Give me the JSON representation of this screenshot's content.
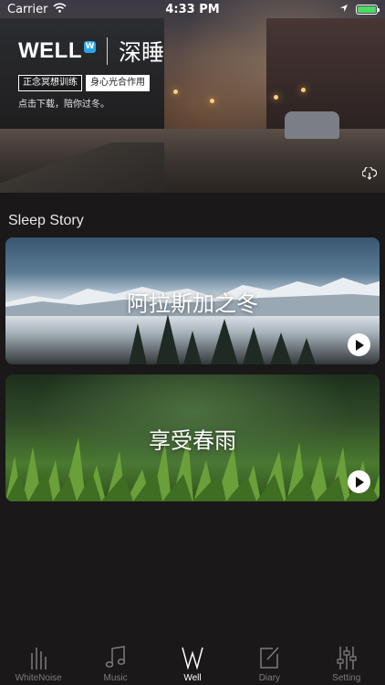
{
  "status_bar": {
    "carrier": "Carrier",
    "time": "4:33 PM"
  },
  "hero": {
    "logo_text": "WELL",
    "logo_badge": "W",
    "title": "深睡",
    "tags": [
      "正念冥想训练",
      "身心光合作用"
    ],
    "note": "点击下载，陪你过冬。"
  },
  "section": {
    "title": "Sleep Story"
  },
  "stories": [
    {
      "title": "阿拉斯加之冬",
      "icon": "play-icon"
    },
    {
      "title": "享受春雨",
      "icon": "play-icon"
    }
  ],
  "tabbar": {
    "items": [
      {
        "label": "WhiteNoise",
        "icon": "whitenoise-icon"
      },
      {
        "label": "Music",
        "icon": "music-note-icon"
      },
      {
        "label": "Well",
        "icon": "well-icon",
        "active": true
      },
      {
        "label": "Diary",
        "icon": "diary-icon"
      },
      {
        "label": "Setting",
        "icon": "sliders-icon"
      }
    ]
  },
  "colors": {
    "background": "#1a1818",
    "accent": "#2aa7e8",
    "battery": "#4cd964",
    "tab_inactive": "#7e7b7b"
  }
}
